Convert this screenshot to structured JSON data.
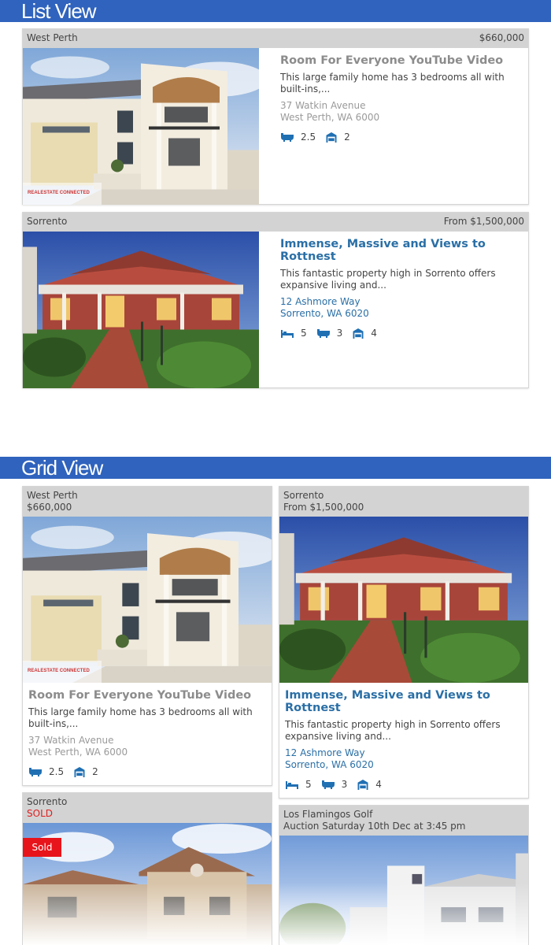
{
  "sections": {
    "list_title": "List View",
    "grid_title": "Grid View"
  },
  "colors": {
    "header_bar": "#2f63bd",
    "link_blue": "#2a6fa6",
    "sold_red": "#e8141b"
  },
  "listings": [
    {
      "suburb": "West Perth",
      "price": "$660,000",
      "title": "Room For Everyone YouTube Video",
      "description": "This large family home has 3 bedrooms all with built-ins,...",
      "address_line1": "37 Watkin Avenue",
      "address_line2": "West Perth, WA 6000",
      "bathrooms": "2.5",
      "garages": "2",
      "logo_text": "REALESTATE CONNECTED"
    },
    {
      "suburb": "Sorrento",
      "price": "From $1,500,000",
      "title": "Immense, Massive and Views to Rottnest",
      "description": "This fantastic property high in Sorrento offers expansive living and...",
      "address_line1": "12 Ashmore Way",
      "address_line2": "Sorrento, WA 6020",
      "bedrooms": "5",
      "bathrooms": "3",
      "garages": "4"
    },
    {
      "suburb": "Sorrento",
      "price": "SOLD",
      "badge": "Sold"
    },
    {
      "suburb": "Los Flamingos Golf",
      "price": "Auction Saturday 10th Dec at 3:45 pm"
    }
  ]
}
